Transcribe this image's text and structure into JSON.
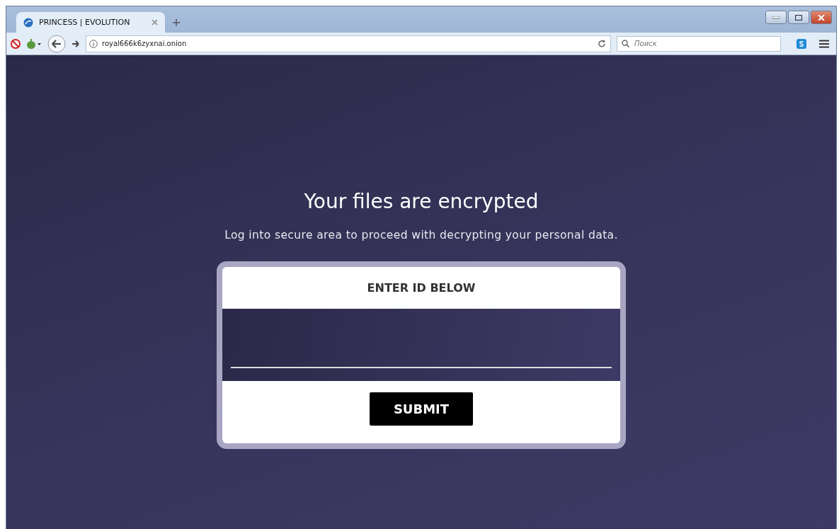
{
  "browser": {
    "tab": {
      "title": "PRINCESS | EVOLUTION",
      "selected": true
    },
    "address": "royal666k6zyxnai.onion",
    "search": {
      "placeholder": "Поиск"
    }
  },
  "page": {
    "heading": "Your files are encrypted",
    "subheading": "Log into secure area to proceed with decrypting your personal data.",
    "card": {
      "title": "ENTER ID BELOW",
      "button": "SUBMIT"
    }
  }
}
